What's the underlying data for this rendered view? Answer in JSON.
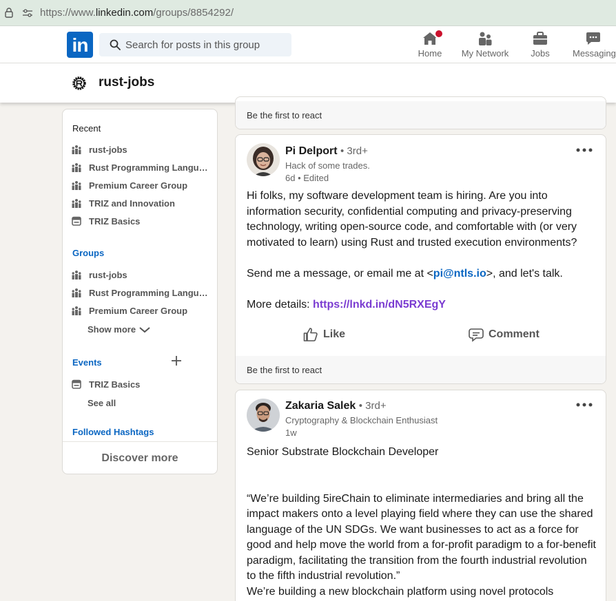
{
  "browser": {
    "url_prefix": "https://www.",
    "url_domain": "linkedin.com",
    "url_path": "/groups/8854292/"
  },
  "nav": {
    "logo_text": "in",
    "search_placeholder": "Search for posts in this group",
    "items": [
      {
        "label": "Home",
        "icon": "home-icon",
        "notification": true
      },
      {
        "label": "My Network",
        "icon": "network-icon"
      },
      {
        "label": "Jobs",
        "icon": "briefcase-icon"
      },
      {
        "label": "Messaging",
        "icon": "messaging-icon"
      }
    ],
    "accent": "#0a66c2",
    "badge_color": "#cb112d"
  },
  "group": {
    "name": "rust-jobs",
    "icon": "rust-logo-icon"
  },
  "sidebar": {
    "recent_heading": "Recent",
    "recent": [
      {
        "label": "rust-jobs",
        "icon": "group-icon"
      },
      {
        "label": "Rust Programming Language",
        "icon": "group-icon"
      },
      {
        "label": "Premium Career Group",
        "icon": "group-icon"
      },
      {
        "label": "TRIZ and Innovation",
        "icon": "group-icon"
      },
      {
        "label": "TRIZ Basics",
        "icon": "calendar-icon"
      }
    ],
    "groups_heading": "Groups",
    "groups": [
      {
        "label": "rust-jobs",
        "icon": "group-icon"
      },
      {
        "label": "Rust Programming Language",
        "icon": "group-icon"
      },
      {
        "label": "Premium Career Group",
        "icon": "group-icon"
      }
    ],
    "show_more": "Show more",
    "events_heading": "Events",
    "events": [
      {
        "label": "TRIZ Basics",
        "icon": "calendar-icon"
      }
    ],
    "see_all": "See all",
    "hashtags_heading": "Followed Hashtags",
    "discover_more": "Discover more"
  },
  "feed": {
    "top_react_text": "Be the first to react",
    "posts": [
      {
        "author": "Pi Delport",
        "degree": "• 3rd+",
        "headline": "Hack of some trades.",
        "meta": "6d • Edited",
        "body_p1": "Hi folks, my software development team is hiring. Are you into information security, confidential computing and privacy-preserving technology, writing open-source code, and comfortable with (or very motivated to learn) using Rust and trusted execution environments?",
        "body_p2_before": " Send me a message, or email me at <",
        "body_p2_link": "pi@ntls.io",
        "body_p2_after": ">, and let's talk.",
        "body_p3_label": "More details: ",
        "body_p3_link": "https://lnkd.in/dN5RXEgY",
        "like_label": "Like",
        "comment_label": "Comment",
        "react_text": "Be the first to react"
      },
      {
        "author": "Zakaria Salek",
        "degree": "• 3rd+",
        "headline": "Cryptography & Blockchain Enthusiast",
        "meta": "1w",
        "body_p1": "Senior Substrate Blockchain Developer",
        "body_p2": "“We’re building 5ireChain to eliminate intermediaries and bring all the impact makers onto a level playing field where they can use the shared language of the UN SDGs. We want businesses to act as a force for good and help move the world from a for-profit paradigm to a for-benefit paradigm, facilitating the transition from the fourth industrial revolution to the fifth industrial revolution.”",
        "body_p3": "We’re building a new blockchain platform using novel protocols"
      }
    ]
  }
}
